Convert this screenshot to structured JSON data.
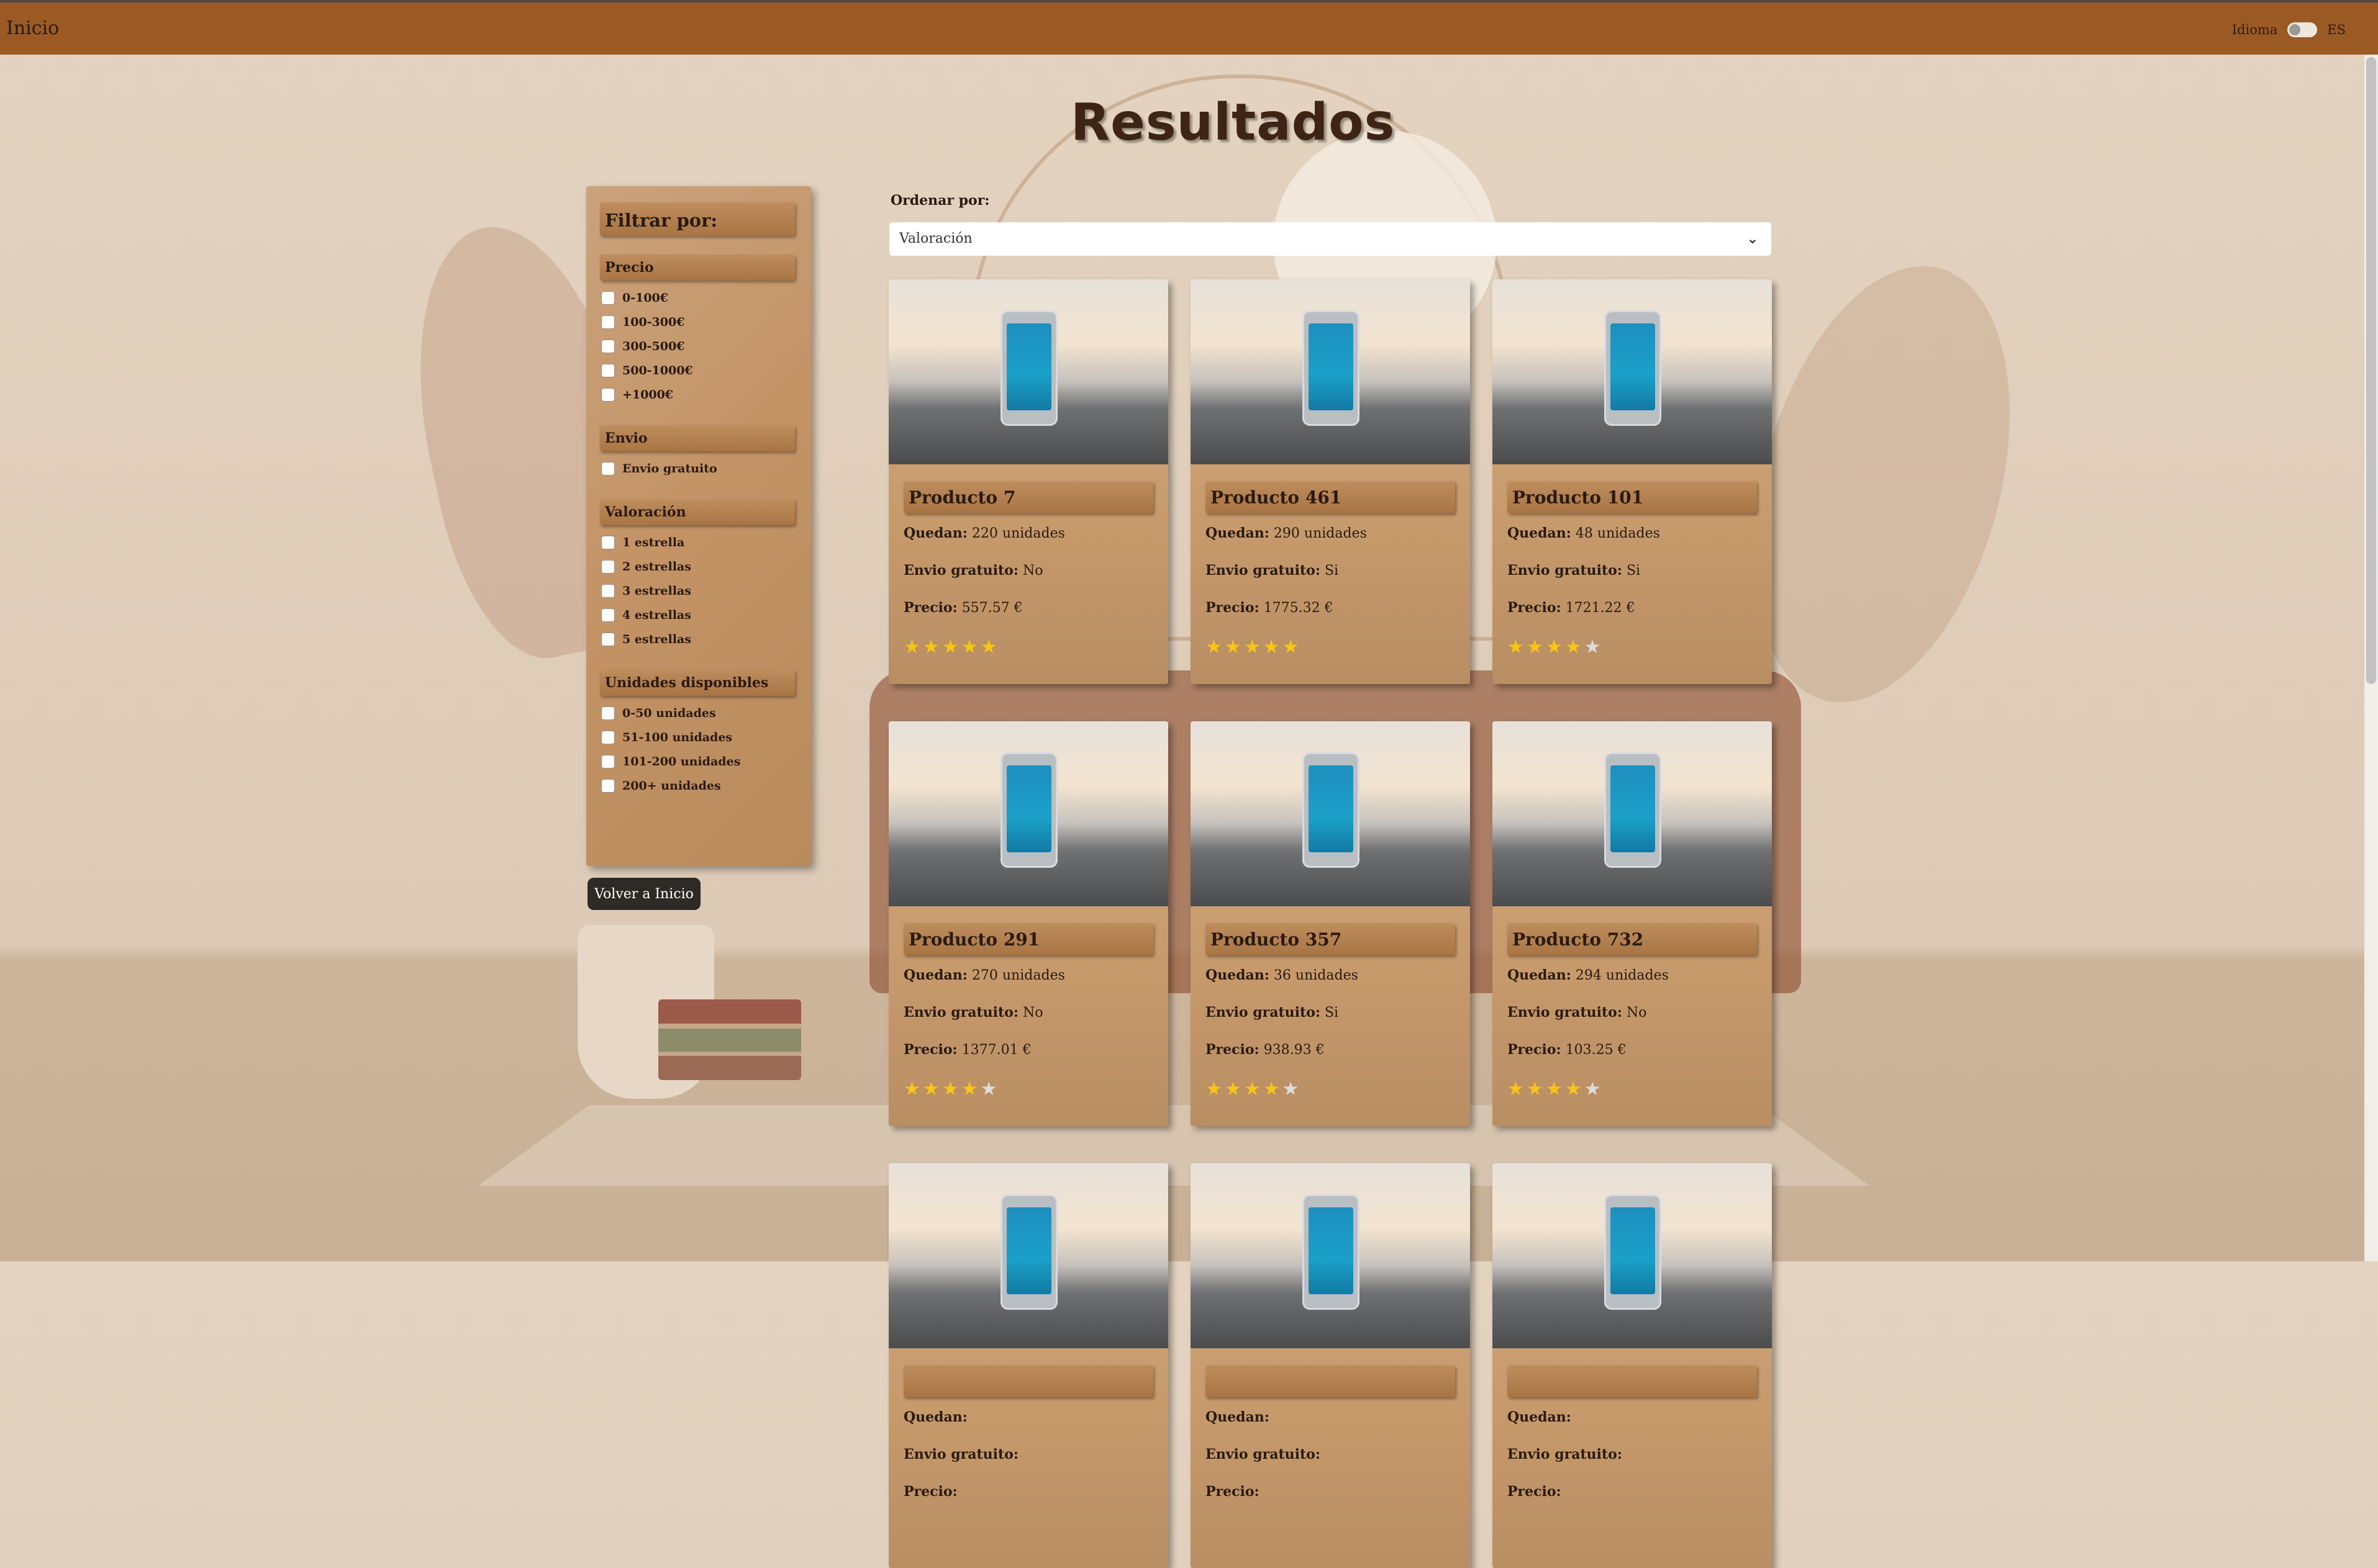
{
  "nav": {
    "home_label": "Inicio",
    "language_label": "Idioma",
    "language_value": "ES"
  },
  "page": {
    "title": "Resultados",
    "back_button": "Volver a Inicio"
  },
  "filters": {
    "title": "Filtrar por:",
    "sections": [
      {
        "title": "Precio",
        "options": [
          "0-100€",
          "100-300€",
          "300-500€",
          "500-1000€",
          "+1000€"
        ]
      },
      {
        "title": "Envio",
        "options": [
          "Envio gratuito"
        ]
      },
      {
        "title": "Valoración",
        "options": [
          "1 estrella",
          "2 estrellas",
          "3 estrellas",
          "4 estrellas",
          "5 estrellas"
        ]
      },
      {
        "title": "Unidades disponibles",
        "options": [
          "0-50 unidades",
          "51-100 unidades",
          "101-200 unidades",
          "200+ unidades"
        ]
      }
    ]
  },
  "sort": {
    "label": "Ordenar por:",
    "selected": "Valoración"
  },
  "product_labels": {
    "remaining": "Quedan:",
    "free_shipping": "Envio gratuito:",
    "price": "Precio:"
  },
  "products": [
    {
      "name": "Producto 7",
      "remaining": "220 unidades",
      "free_shipping": "No",
      "price": "557.57 €",
      "rating": 5
    },
    {
      "name": "Producto 461",
      "remaining": "290 unidades",
      "free_shipping": "Si",
      "price": "1775.32 €",
      "rating": 5
    },
    {
      "name": "Producto 101",
      "remaining": "48 unidades",
      "free_shipping": "Si",
      "price": "1721.22 €",
      "rating": 4
    },
    {
      "name": "Producto 291",
      "remaining": "270 unidades",
      "free_shipping": "No",
      "price": "1377.01 €",
      "rating": 4
    },
    {
      "name": "Producto 357",
      "remaining": "36 unidades",
      "free_shipping": "Si",
      "price": "938.93 €",
      "rating": 4
    },
    {
      "name": "Producto 732",
      "remaining": "294 unidades",
      "free_shipping": "No",
      "price": "103.25 €",
      "rating": 4
    },
    {
      "name": "",
      "remaining": "",
      "free_shipping": "",
      "price": "",
      "rating": null
    },
    {
      "name": "",
      "remaining": "",
      "free_shipping": "",
      "price": "",
      "rating": null
    },
    {
      "name": "",
      "remaining": "",
      "free_shipping": "",
      "price": "",
      "rating": null
    }
  ],
  "colors": {
    "navbar": "#9b5a24",
    "star_filled": "#f5c518",
    "star_empty": "#dcdcdc",
    "panel": "#c49467"
  }
}
